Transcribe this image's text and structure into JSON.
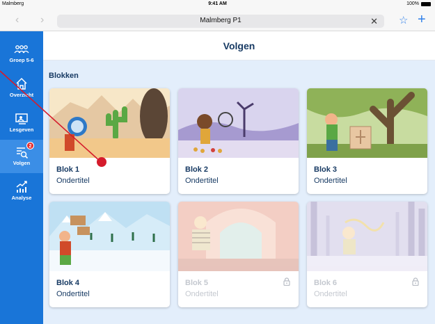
{
  "status": {
    "carrier": "Malmberg",
    "time": "9:41 AM",
    "battery": "100%"
  },
  "browser": {
    "url": "Malmberg P1",
    "back_icon": "chevron-left-icon",
    "forward_icon": "chevron-right-icon"
  },
  "sidebar": {
    "items": [
      {
        "label": "Groep 5-6",
        "icon": "group-icon"
      },
      {
        "label": "Overzicht",
        "icon": "home-icon"
      },
      {
        "label": "Lesgeven",
        "icon": "teach-icon"
      },
      {
        "label": "Volgen",
        "icon": "follow-icon",
        "badge": "2"
      },
      {
        "label": "Analyse",
        "icon": "analysis-icon"
      }
    ]
  },
  "header": {
    "title": "Volgen"
  },
  "section": {
    "title": "Blokken"
  },
  "cards": [
    {
      "name": "Blok 1",
      "subtitle": "Ondertitel",
      "locked": false
    },
    {
      "name": "Blok 2",
      "subtitle": "Ondertitel",
      "locked": false
    },
    {
      "name": "Blok 3",
      "subtitle": "Ondertitel",
      "locked": false
    },
    {
      "name": "Blok 4",
      "subtitle": "Ondertitel",
      "locked": false
    },
    {
      "name": "Blok 5",
      "subtitle": "Ondertitel",
      "locked": true
    },
    {
      "name": "Blok 6",
      "subtitle": "Ondertitel",
      "locked": true
    }
  ],
  "colors": {
    "sidebar": "#1975d8",
    "accent": "#2f7fe9",
    "title_text": "#173a63",
    "content_bg": "#e3eefb",
    "annotation": "#d51c2c"
  }
}
